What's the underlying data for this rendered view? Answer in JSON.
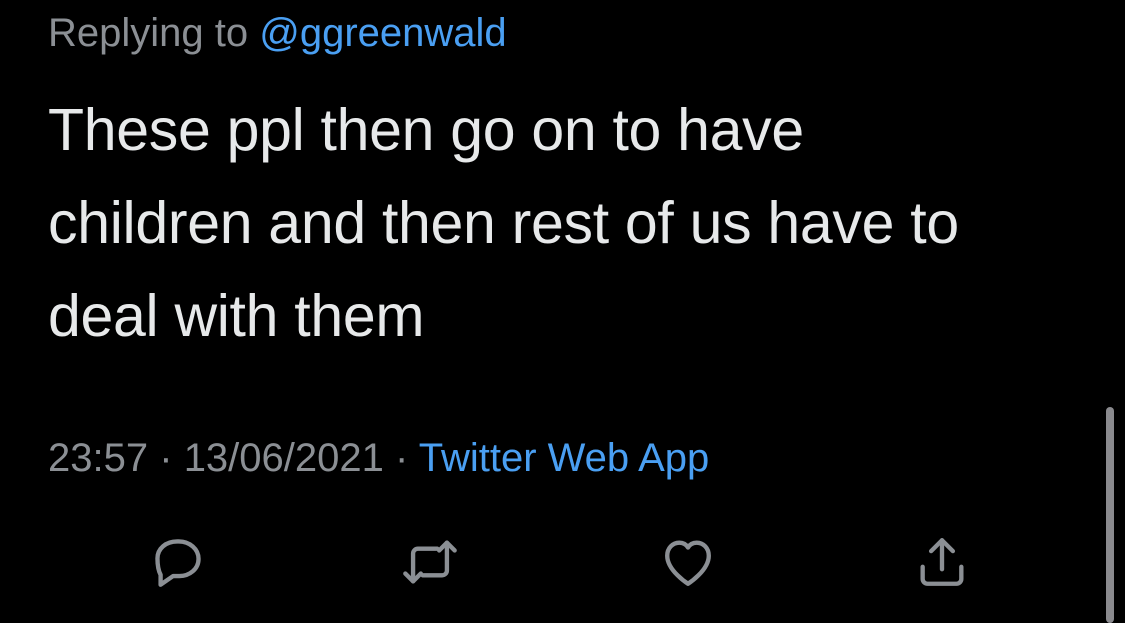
{
  "reply": {
    "prefix": "Replying to",
    "handle": "@ggreenwald"
  },
  "tweet": {
    "lines": [
      "These ppl then go on to have",
      "children and then rest of us have to",
      "deal with them"
    ]
  },
  "meta": {
    "time": "23:57",
    "separator1": "·",
    "date": "13/06/2021",
    "separator2": "·",
    "source": "Twitter Web App"
  },
  "actions": {
    "reply_icon": "reply-icon",
    "retweet_icon": "retweet-icon",
    "like_icon": "heart-icon",
    "share_icon": "share-icon"
  },
  "colors": {
    "background": "#000000",
    "text": "#e7e9ea",
    "muted": "#8b8f94",
    "link": "#4a9ff2"
  }
}
